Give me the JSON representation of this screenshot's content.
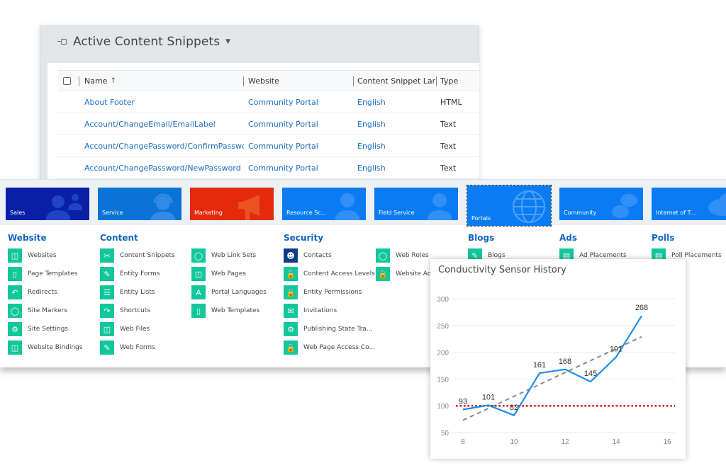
{
  "snippets_view": {
    "title": "Active Content Snippets",
    "columns": [
      "Name",
      "Website",
      "Content Snippet Lan...",
      "Type"
    ],
    "sort_indicator": "↑",
    "rows": [
      {
        "name": "About Footer",
        "website": "Community Portal",
        "language": "English",
        "type": "HTML"
      },
      {
        "name": "Account/ChangeEmail/EmailLabel",
        "website": "Community Portal",
        "language": "English",
        "type": "Text"
      },
      {
        "name": "Account/ChangePassword/ConfirmPassword",
        "website": "Community Portal",
        "language": "English",
        "type": "Text"
      },
      {
        "name": "Account/ChangePassword/NewPassword",
        "website": "Community Portal",
        "language": "English",
        "type": "Text"
      }
    ]
  },
  "apps": [
    {
      "label": "Sales",
      "color": "#0a1fa8",
      "icon": "people-icon"
    },
    {
      "label": "Service",
      "color": "#0b72d6",
      "icon": "headset-icon"
    },
    {
      "label": "Marketing",
      "color": "#e32a0c",
      "icon": "megaphone-icon"
    },
    {
      "label": "Resource Sc...",
      "color": "#0a7bf2",
      "icon": "person-icon"
    },
    {
      "label": "Field Service",
      "color": "#0a7bf2",
      "icon": "person-icon"
    },
    {
      "label": "Portals",
      "color": "#0a7bf2",
      "icon": "globe-icon",
      "selected": true
    },
    {
      "label": "Community",
      "color": "#0a7bf2",
      "icon": "chat-icon"
    },
    {
      "label": "Internet of T...",
      "color": "#0a7bf2",
      "icon": "cloud-icon"
    }
  ],
  "sitemap": {
    "website": {
      "title": "Website",
      "items": [
        "Websites",
        "Page Templates",
        "Redirects",
        "Site Markers",
        "Site Settings",
        "Website Bindings"
      ]
    },
    "content": {
      "title": "Content",
      "items": [
        "Content Snippets",
        "Entity Forms",
        "Entity Lists",
        "Shortcuts",
        "Web Files",
        "Web Forms",
        "Web Link Sets",
        "Web Pages",
        "Portal Languages",
        "Web Templates"
      ]
    },
    "security": {
      "title": "Security",
      "items": [
        "Contacts",
        "Content Access Levels",
        "Entity Permissions",
        "Invitations",
        "Publishing State Tra...",
        "Web Page Access Co...",
        "Web Roles",
        "Website Acc"
      ]
    },
    "blogs": {
      "title": "Blogs",
      "items": [
        "Blogs"
      ]
    },
    "ads": {
      "title": "Ads",
      "items": [
        "Ad Placements"
      ]
    },
    "polls": {
      "title": "Polls",
      "items": [
        "Poll Placements"
      ]
    }
  },
  "chart_data": {
    "type": "line",
    "title": "Conductivity Sensor History",
    "xlabel": "",
    "ylabel": "",
    "xlim": [
      8,
      16
    ],
    "ylim": [
      50,
      300
    ],
    "xticks": [
      8,
      10,
      12,
      14,
      16
    ],
    "yticks": [
      50,
      100,
      150,
      200,
      250,
      300
    ],
    "grid": true,
    "series": [
      {
        "name": "Conductivity",
        "color": "#1a8cf0",
        "x": [
          8,
          9,
          10,
          11,
          12,
          13,
          14,
          15
        ],
        "values": [
          93,
          101,
          82,
          161,
          168,
          145,
          191,
          268
        ]
      }
    ],
    "trendline": {
      "color": "#888888",
      "style": "dashed",
      "x": [
        8,
        15
      ],
      "values": [
        73,
        229
      ]
    },
    "threshold": {
      "color": "#e00000",
      "style": "dotted",
      "value": 100
    }
  }
}
